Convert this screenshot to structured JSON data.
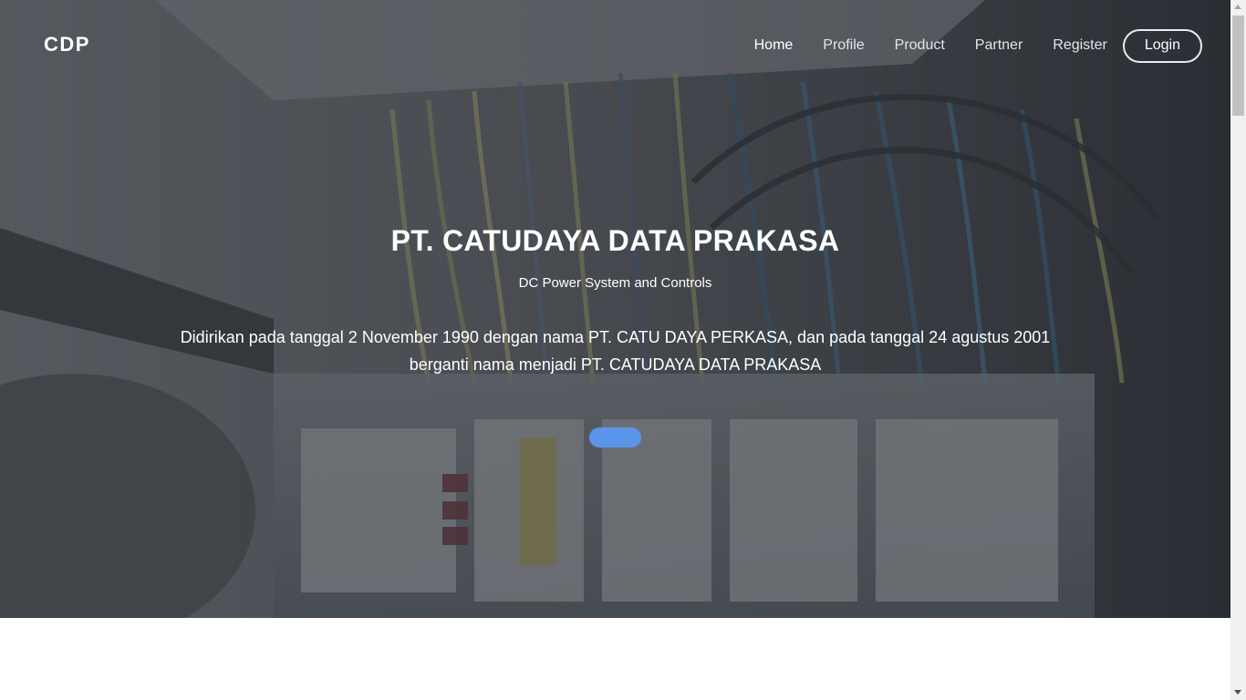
{
  "brand": {
    "logo_text": "CDP"
  },
  "nav": {
    "items": [
      {
        "label": "Home",
        "active": true
      },
      {
        "label": "Profile"
      },
      {
        "label": "Product"
      },
      {
        "label": "Partner"
      },
      {
        "label": "Register"
      }
    ],
    "login_label": "Login"
  },
  "hero": {
    "background": "electrical-panel-wiring-photo",
    "title": "PT. CATUDAYA DATA PRAKASA",
    "subtitle": "DC Power System and Controls",
    "description": "Didirikan pada tanggal 2 November 1990 dengan nama PT. CATU DAYA PERKASA, dan pada tanggal 24 agustus 2001 berganti nama menjadi PT. CATUDAYA DATA PRAKASA",
    "button_color": "#5b95ea"
  },
  "colors": {
    "overlay": "#3b3f45",
    "text": "#ffffff",
    "accent": "#5b95ea"
  }
}
